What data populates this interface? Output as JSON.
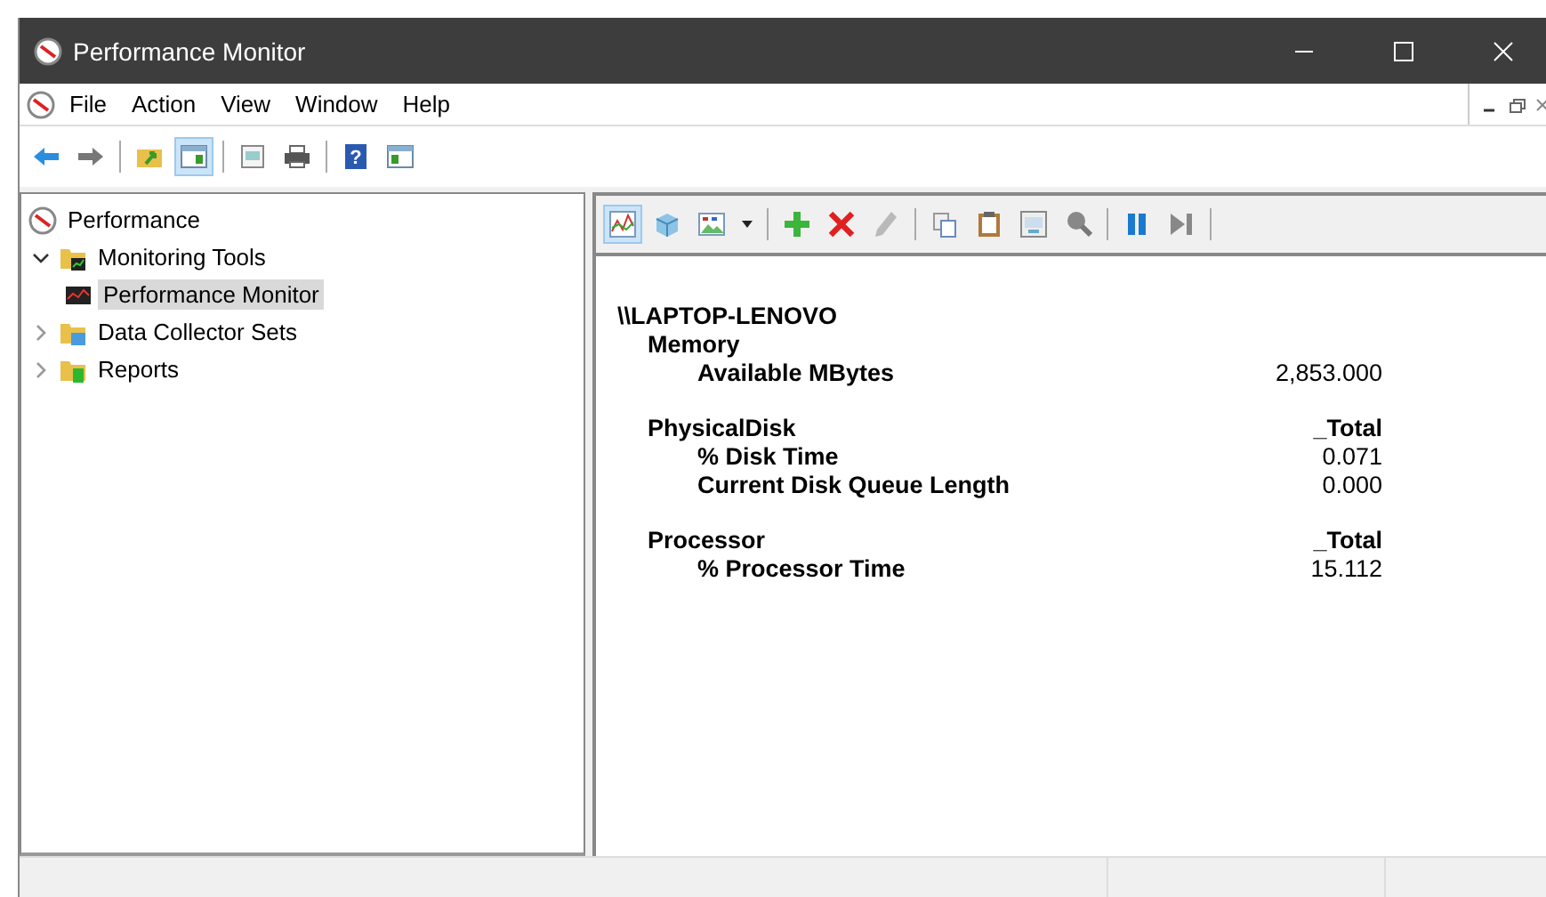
{
  "window": {
    "title": "Performance Monitor"
  },
  "menu": [
    {
      "label": "File"
    },
    {
      "label": "Action"
    },
    {
      "label": "View"
    },
    {
      "label": "Window"
    },
    {
      "label": "Help"
    }
  ],
  "main_toolbar": [
    {
      "kind": "back",
      "selected": false
    },
    {
      "kind": "forward",
      "selected": false
    },
    {
      "kind": "sep"
    },
    {
      "kind": "up",
      "selected": false
    },
    {
      "kind": "tree",
      "selected": true
    },
    {
      "kind": "sep"
    },
    {
      "kind": "export",
      "selected": false
    },
    {
      "kind": "print",
      "selected": false
    },
    {
      "kind": "sep"
    },
    {
      "kind": "help",
      "selected": false,
      "glyph": "?"
    },
    {
      "kind": "pane",
      "selected": false
    }
  ],
  "tree": [
    {
      "label": "Performance",
      "kind": "perf",
      "selected": false,
      "children": [
        {
          "label": "Monitoring Tools",
          "kind": "folder-chart",
          "expanded": true,
          "selected": false,
          "children": [
            {
              "label": "Performance Monitor",
              "kind": "monitor",
              "selected": true
            }
          ]
        },
        {
          "label": "Data Collector Sets",
          "kind": "folder-blue",
          "expanded": false,
          "selected": false
        },
        {
          "label": "Reports",
          "kind": "folder-green",
          "expanded": false,
          "selected": false
        }
      ]
    }
  ],
  "report_toolbar": [
    {
      "kind": "graph",
      "selected": true,
      "disabled": false
    },
    {
      "kind": "cube",
      "selected": false,
      "disabled": false
    },
    {
      "kind": "image",
      "selected": false,
      "disabled": false
    },
    {
      "kind": "caret",
      "selected": false,
      "disabled": false
    },
    {
      "kind": "sep"
    },
    {
      "kind": "add",
      "selected": false,
      "disabled": false
    },
    {
      "kind": "delete",
      "selected": false,
      "disabled": false
    },
    {
      "kind": "pencil",
      "selected": false,
      "disabled": true
    },
    {
      "kind": "sep"
    },
    {
      "kind": "copy",
      "selected": false,
      "disabled": false
    },
    {
      "kind": "clipboard",
      "selected": false,
      "disabled": false
    },
    {
      "kind": "properties",
      "selected": false,
      "disabled": false
    },
    {
      "kind": "zoom",
      "selected": false,
      "disabled": false
    },
    {
      "kind": "sep"
    },
    {
      "kind": "pause",
      "selected": false,
      "disabled": false
    },
    {
      "kind": "step",
      "selected": false,
      "disabled": false
    },
    {
      "kind": "sep"
    }
  ],
  "report": {
    "computer": "\\\\LAPTOP-LENOVO",
    "objects": [
      {
        "name": "Memory",
        "counters": [
          {
            "name": "Available MBytes",
            "value": "2,853.000"
          }
        ]
      },
      {
        "name": "PhysicalDisk",
        "instance": "_Total",
        "counters": [
          {
            "name": "% Disk Time",
            "value": "0.071"
          },
          {
            "name": "Current Disk Queue Length",
            "value": "0.000"
          }
        ]
      },
      {
        "name": "Processor",
        "instance": "_Total",
        "counters": [
          {
            "name": "% Processor Time",
            "value": "15.112"
          }
        ]
      }
    ]
  }
}
